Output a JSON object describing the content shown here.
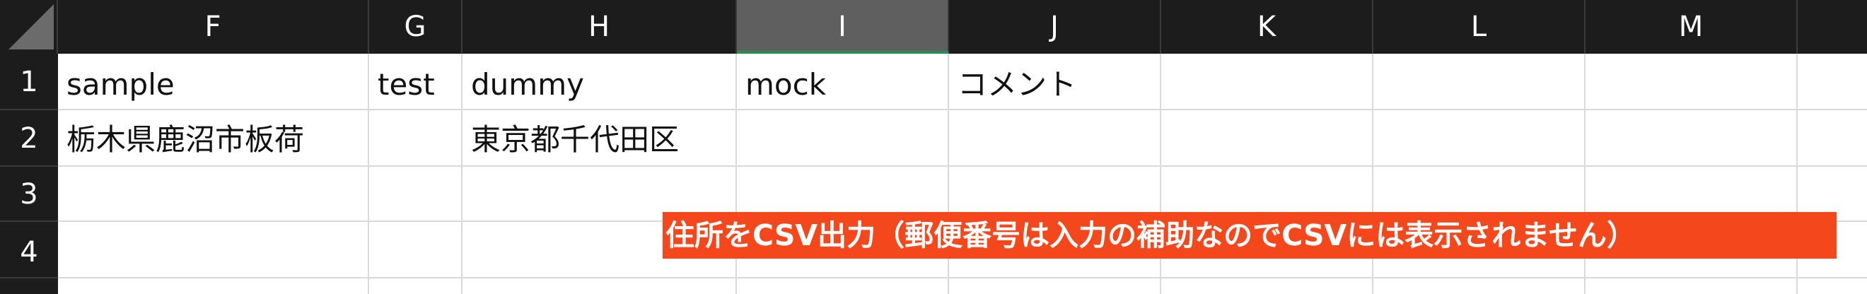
{
  "columns": [
    {
      "letter": "F"
    },
    {
      "letter": "G"
    },
    {
      "letter": "H"
    },
    {
      "letter": "I",
      "selected": true
    },
    {
      "letter": "J"
    },
    {
      "letter": "K"
    },
    {
      "letter": "L"
    },
    {
      "letter": "M"
    },
    {
      "letter": ""
    }
  ],
  "rows": [
    "1",
    "2",
    "3",
    "4",
    ""
  ],
  "cells": [
    [
      "sample",
      "test",
      "dummy",
      "mock",
      "コメント",
      "",
      "",
      "",
      ""
    ],
    [
      "栃木県鹿沼市板荷",
      "",
      "東京都千代田区",
      "",
      "",
      "",
      "",
      "",
      ""
    ],
    [
      "",
      "",
      "",
      "",
      "",
      "",
      "",
      "",
      ""
    ],
    [
      "",
      "",
      "",
      "",
      "",
      "",
      "",
      "",
      ""
    ],
    [
      "",
      "",
      "",
      "",
      "",
      "",
      "",
      "",
      ""
    ]
  ],
  "overlay_note": "住所をCSV出力（郵便番号は入力の補助なのでCSVには表示されません）",
  "colors": {
    "header_bg": "#1c1c1c",
    "selected_header_bg": "#5f5f5f",
    "selected_underline": "#2e8b57",
    "gridline": "#d9d9d9",
    "note_bg": "#f4471c"
  }
}
